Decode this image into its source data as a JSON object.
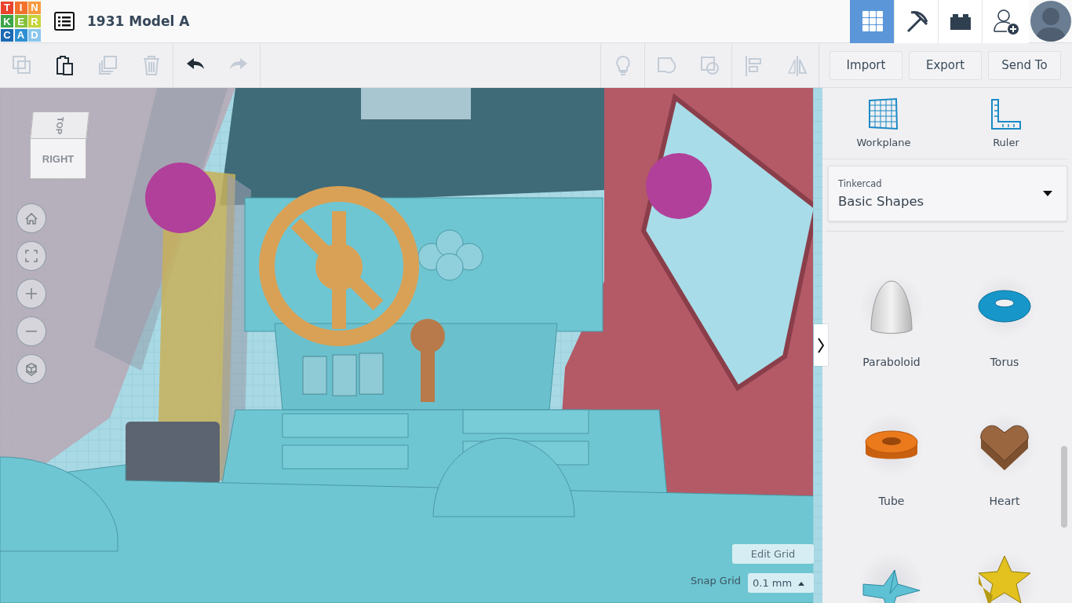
{
  "header": {
    "logo_letters": [
      {
        "letter": "T",
        "color": "#e9432d"
      },
      {
        "letter": "I",
        "color": "#f2712b"
      },
      {
        "letter": "N",
        "color": "#f79a3e"
      },
      {
        "letter": "K",
        "color": "#3aa548"
      },
      {
        "letter": "E",
        "color": "#84c13a"
      },
      {
        "letter": "R",
        "color": "#c6d43a"
      },
      {
        "letter": "C",
        "color": "#1c69b3"
      },
      {
        "letter": "A",
        "color": "#2f8fd2"
      },
      {
        "letter": "D",
        "color": "#8bc6ec"
      }
    ],
    "title": "1931 Model A",
    "view_modes": [
      {
        "kind": "grid",
        "selected": true
      },
      {
        "kind": "pickaxe",
        "selected": false
      },
      {
        "kind": "brick",
        "selected": false
      }
    ]
  },
  "toolbar": {
    "tools": [
      {
        "kind": "copy",
        "disabled": true
      },
      {
        "kind": "paste",
        "disabled": false
      },
      {
        "kind": "duplicate",
        "disabled": true
      },
      {
        "kind": "delete",
        "disabled": true
      },
      {
        "kind": "undo",
        "disabled": false
      },
      {
        "kind": "redo",
        "disabled": true
      }
    ],
    "shape_tools": [
      {
        "kind": "bulb",
        "disabled": true
      },
      {
        "kind": "group",
        "disabled": true
      },
      {
        "kind": "ungroup",
        "disabled": true
      },
      {
        "kind": "align",
        "disabled": true
      },
      {
        "kind": "mirror",
        "disabled": true
      }
    ],
    "buttons": [
      "Import",
      "Export",
      "Send To"
    ]
  },
  "viewport": {
    "view_cube": {
      "top": "TOP",
      "side": "RIGHT"
    },
    "edit_grid": "Edit Grid",
    "snap_grid": {
      "label": "Snap Grid",
      "value": "0.1 mm"
    }
  },
  "sidebar": {
    "tools": [
      {
        "kind": "workplane",
        "label": "Workplane"
      },
      {
        "kind": "ruler",
        "label": "Ruler"
      }
    ],
    "library": {
      "source": "Tinkercad",
      "category": "Basic Shapes"
    },
    "shapes": [
      {
        "kind": "paraboloid",
        "label": "Paraboloid"
      },
      {
        "kind": "torus",
        "label": "Torus"
      },
      {
        "kind": "tube",
        "label": "Tube"
      },
      {
        "kind": "heart",
        "label": "Heart"
      },
      {
        "kind": "star-pyramid"
      },
      {
        "kind": "star"
      }
    ]
  }
}
